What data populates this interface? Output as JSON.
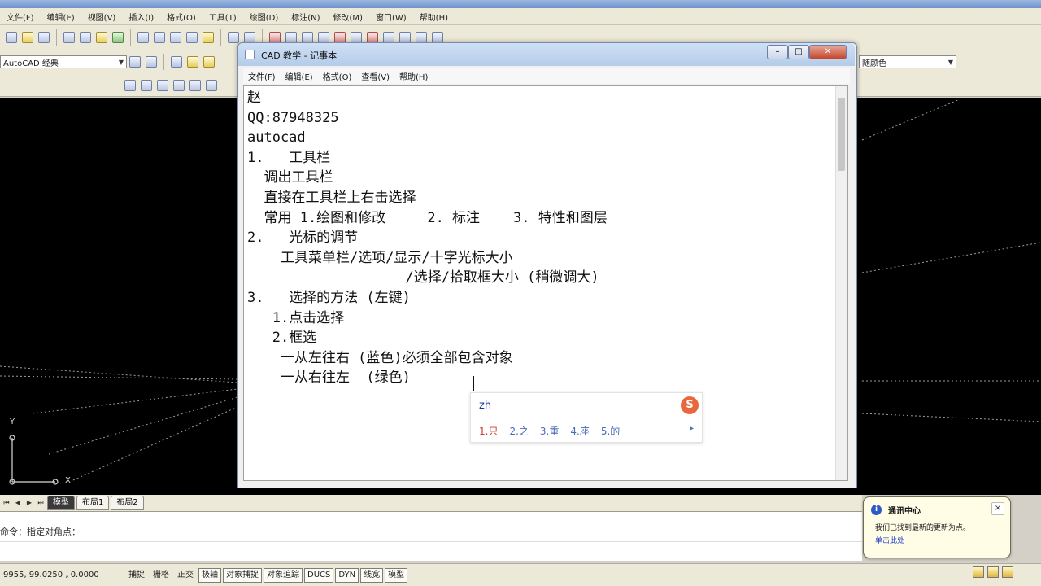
{
  "acad": {
    "menus": [
      "文件(F)",
      "编辑(E)",
      "视图(V)",
      "插入(I)",
      "格式(O)",
      "工具(T)",
      "绘图(D)",
      "标注(N)",
      "修改(M)",
      "窗口(W)",
      "帮助(H)"
    ],
    "workspace_label": "AutoCAD 经典",
    "color_combo_label": "随颜色",
    "layout_tabs": [
      "模型",
      "布局1",
      "布局2"
    ],
    "command_prompt": "命令：指定对角点：",
    "coordinates": "9955, 99.0250 , 0.0000",
    "status_toggles": [
      {
        "label": "捕捉",
        "on": false
      },
      {
        "label": "栅格",
        "on": false
      },
      {
        "label": "正交",
        "on": false
      },
      {
        "label": "极轴",
        "on": true
      },
      {
        "label": "对象捕捉",
        "on": true
      },
      {
        "label": "对象追踪",
        "on": true
      },
      {
        "label": "DUCS",
        "on": true
      },
      {
        "label": "DYN",
        "on": true
      },
      {
        "label": "线宽",
        "on": true
      },
      {
        "label": "模型",
        "on": true
      }
    ],
    "ucs_x": "X",
    "ucs_y": "Y"
  },
  "notepad": {
    "title": "CAD 教学 - 记事本",
    "menus": [
      "文件(F)",
      "编辑(E)",
      "格式(O)",
      "查看(V)",
      "帮助(H)"
    ],
    "text": "赵\nQQ:87948325\nautocad\n1.   工具栏\n  调出工具栏\n  直接在工具栏上右击选择\n  常用 1.绘图和修改     2. 标注    3. 特性和图层\n2.   光标的调节\n    工具菜单栏/选项/显示/十字光标大小\n                   /选择/拾取框大小 (稍微调大)\n3.   选择的方法 (左键)\n   1.点击选择\n   2.框选\n    一从左往右 (蓝色)必须全部包含对象\n    一从右往左  (绿色)"
  },
  "ime": {
    "input": "zh",
    "candidates": [
      "1.只",
      "2.之",
      "3.重",
      "4.座",
      "5.的"
    ],
    "next_symbol": "▸",
    "logo": "S"
  },
  "balloon": {
    "title": "通讯中心",
    "text": "我们已找到最新的更新为点。",
    "link": "单击此处"
  },
  "colors": {
    "drawing_bg": "#000000",
    "chrome_bg": "#ece9d8",
    "notepad_title": "#b4cce9",
    "close_btn": "#c6452c"
  }
}
